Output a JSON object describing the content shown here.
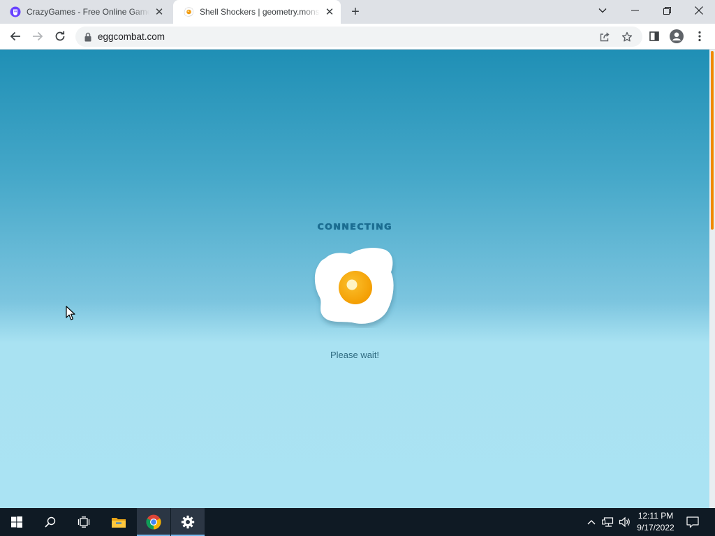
{
  "browser": {
    "tabs": [
      {
        "title": "CrazyGames - Free Online Games on CrazyGames.com",
        "favicon": "crazygames-icon",
        "active": false
      },
      {
        "title": "Shell Shockers | geometry.monster",
        "favicon": "egg-favicon-icon",
        "active": true
      }
    ],
    "new_tab": "+",
    "address": "eggcombat.com"
  },
  "page": {
    "status_title": "CONNECTING",
    "status_message": "Please wait!",
    "colors": {
      "sky_top": "#1f8fb5",
      "sky_bottom": "#aae3f3",
      "title_color": "#1b6d91",
      "yolk": "#f9a602",
      "scroll_thumb": "#f08a00"
    }
  },
  "taskbar": {
    "apps": [
      "windows-start-icon",
      "search-icon",
      "task-view-icon",
      "file-explorer-icon",
      "chrome-icon",
      "settings-icon"
    ],
    "time": "12:11 PM",
    "date": "9/17/2022"
  }
}
